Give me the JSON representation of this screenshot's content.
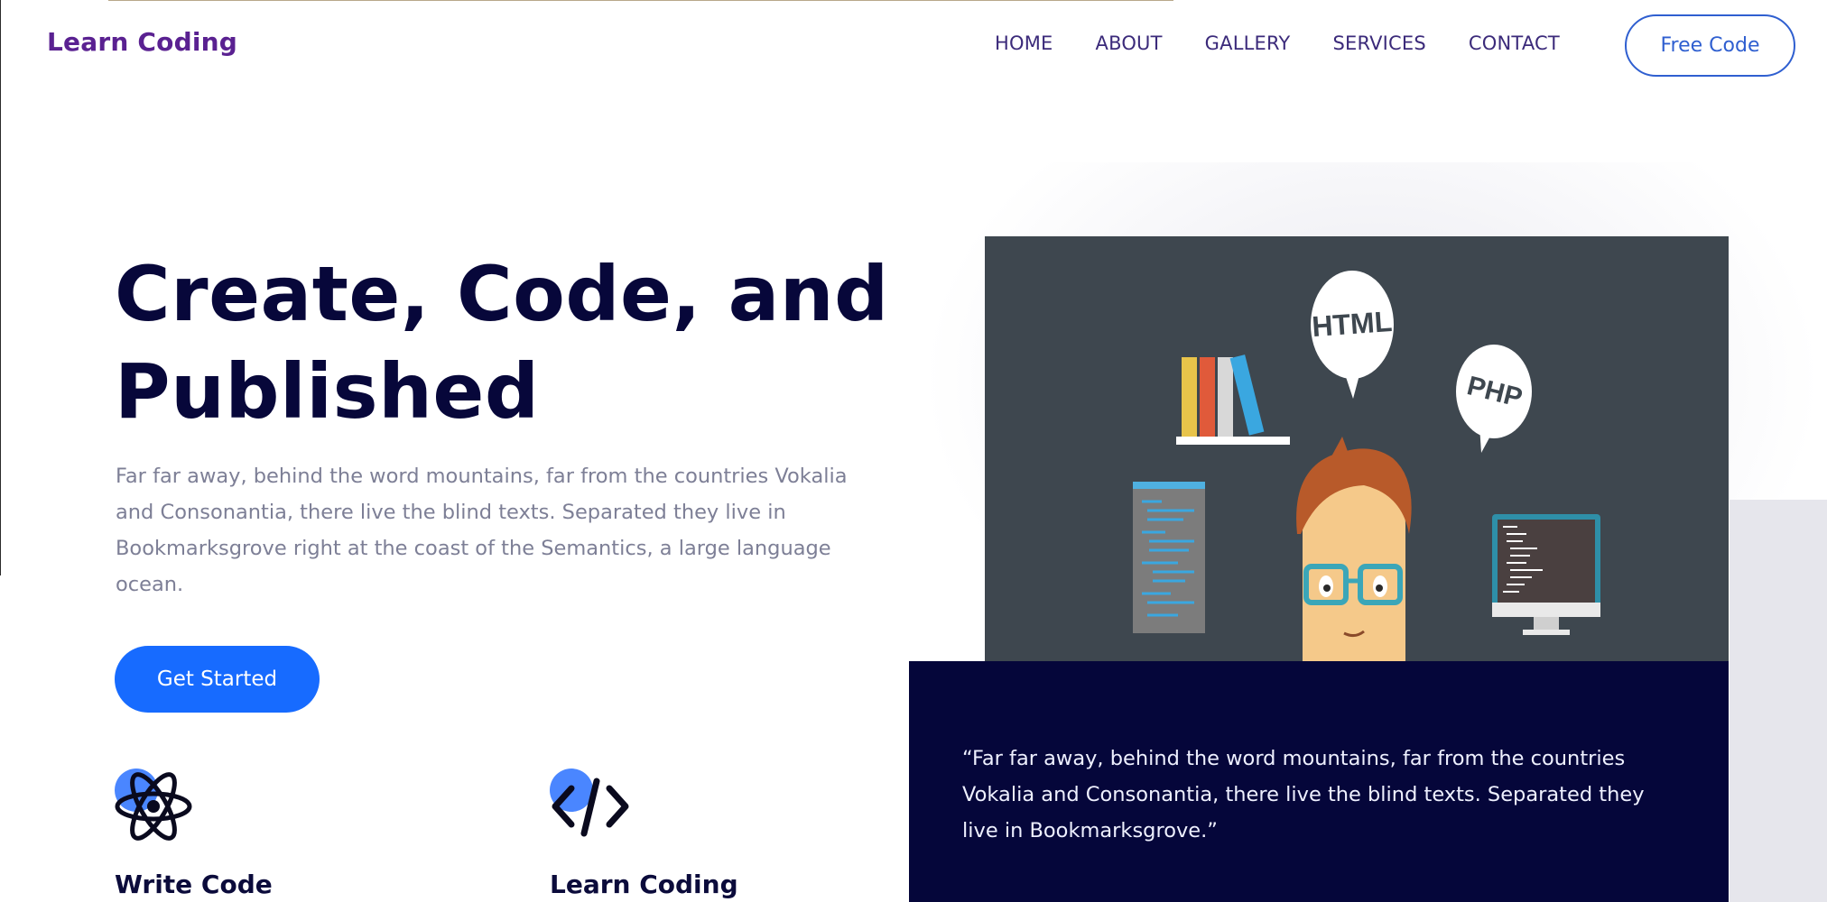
{
  "header": {
    "brand": "Learn Coding",
    "nav": [
      "HOME",
      "ABOUT",
      "GALLERY",
      "SERVICES",
      "CONTACT"
    ],
    "free_code_label": "Free Code"
  },
  "hero": {
    "title_line1": "Create, Code, and",
    "title_line2": "Published",
    "description": "Far far away, behind the word mountains, far from the countries Vokalia and Consonantia, there live the blind texts. Separated they live in Bookmarksgrove right at the coast of the Semantics, a large language ocean.",
    "cta_label": "Get Started"
  },
  "features": [
    {
      "icon": "atom-icon",
      "title": "Write Code"
    },
    {
      "icon": "code-brackets-icon",
      "title": "Learn Coding"
    }
  ],
  "illustration": {
    "bubble_html": "HTML",
    "bubble_php": "PHP"
  },
  "quote": {
    "text": "“Far far away, behind the word mountains, far from the countries Vokalia and Consonantia, there live the blind texts. Separated they live in Bookmarksgrove.”"
  },
  "colors": {
    "brand": "#5a2191",
    "accent": "#176bff",
    "heading": "#07073a",
    "quote_bg": "#05063a",
    "illustration_bg": "#3e474f"
  }
}
